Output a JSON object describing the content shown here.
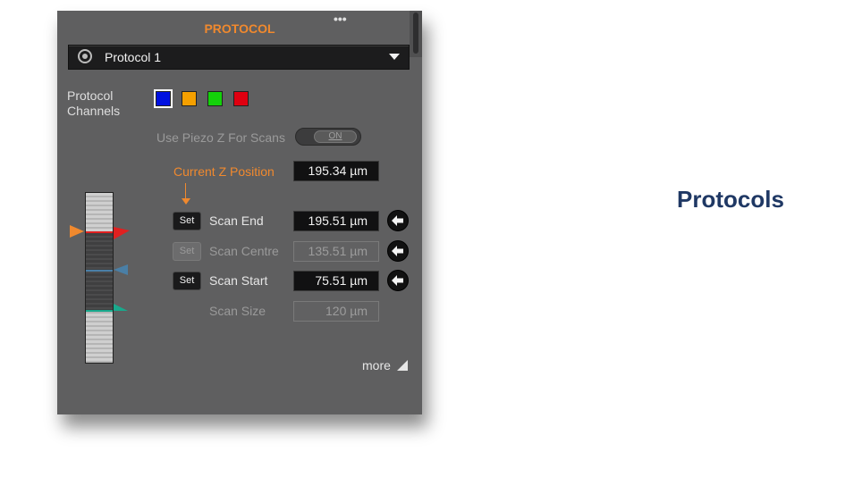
{
  "panel": {
    "title": "PROTOCOL",
    "menu_icon": "more-dots-icon",
    "protocol_select": {
      "value": "Protocol 1",
      "icon": "protocol-icon"
    },
    "channels": {
      "label": "Protocol\nChannels",
      "colors": [
        "#0010e0",
        "#f5a000",
        "#14d20a",
        "#e00010"
      ],
      "selected_index": 0
    },
    "piezo": {
      "label": "Use Piezo Z For Scans",
      "toggle": "ON"
    },
    "current_z": {
      "label": "Current Z Position",
      "value": "195.34 µm"
    },
    "rows": [
      {
        "set": "Set",
        "label": "Scan End",
        "value": "195.51 µm",
        "enabled": true
      },
      {
        "set": "Set",
        "label": "Scan Centre",
        "value": "135.51 µm",
        "enabled": false
      },
      {
        "set": "Set",
        "label": "Scan Start",
        "value": "75.51 µm",
        "enabled": true
      },
      {
        "label": "Scan Size",
        "value": "120 µm",
        "enabled": false
      }
    ],
    "z_markers": {
      "current_color": "#f0892e",
      "end_color": "#e02020",
      "centre_color": "#4a7fa6",
      "start_color": "#19a98c"
    },
    "more_label": "more"
  },
  "slide": {
    "title": "Protocols"
  }
}
